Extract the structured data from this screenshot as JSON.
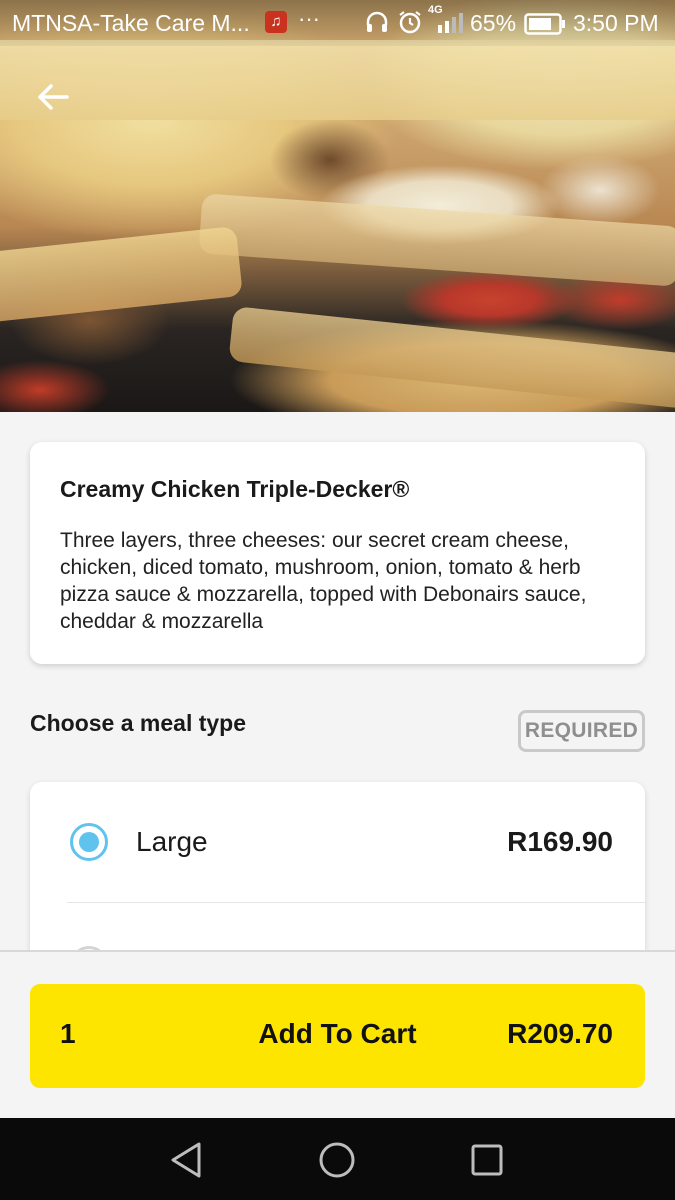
{
  "status_bar": {
    "carrier": "MTNSA-Take Care M...",
    "overflow": "···",
    "network": "4G",
    "battery_percent": "65%",
    "time": "3:50 PM",
    "icons": [
      "music-icon",
      "headphone-icon",
      "alarm-icon",
      "signal-icon",
      "battery-icon"
    ]
  },
  "header": {
    "back_icon": "arrow-left-icon"
  },
  "product": {
    "name": "Creamy Chicken Triple-Decker®",
    "description": "Three layers, three cheeses: our secret cream cheese, chicken, diced tomato, mushroom, onion, tomato & herb pizza sauce & mozzarella, topped with Debonairs sauce, cheddar & mozzarella"
  },
  "meal_type": {
    "title": "Choose a meal type",
    "badge": "REQUIRED",
    "options": [
      {
        "label": "Large",
        "price": "R169.90",
        "selected": true
      },
      {
        "label": "",
        "price": "",
        "selected": false
      }
    ]
  },
  "cart": {
    "quantity": "1",
    "label": "Add To Cart",
    "total": "R209.70",
    "color": "#fde500"
  },
  "colors": {
    "accent": "#5fc3ee",
    "button": "#fde500"
  },
  "nav_bar": {
    "icons": [
      "nav-back-icon",
      "nav-home-icon",
      "nav-recent-icon"
    ]
  }
}
